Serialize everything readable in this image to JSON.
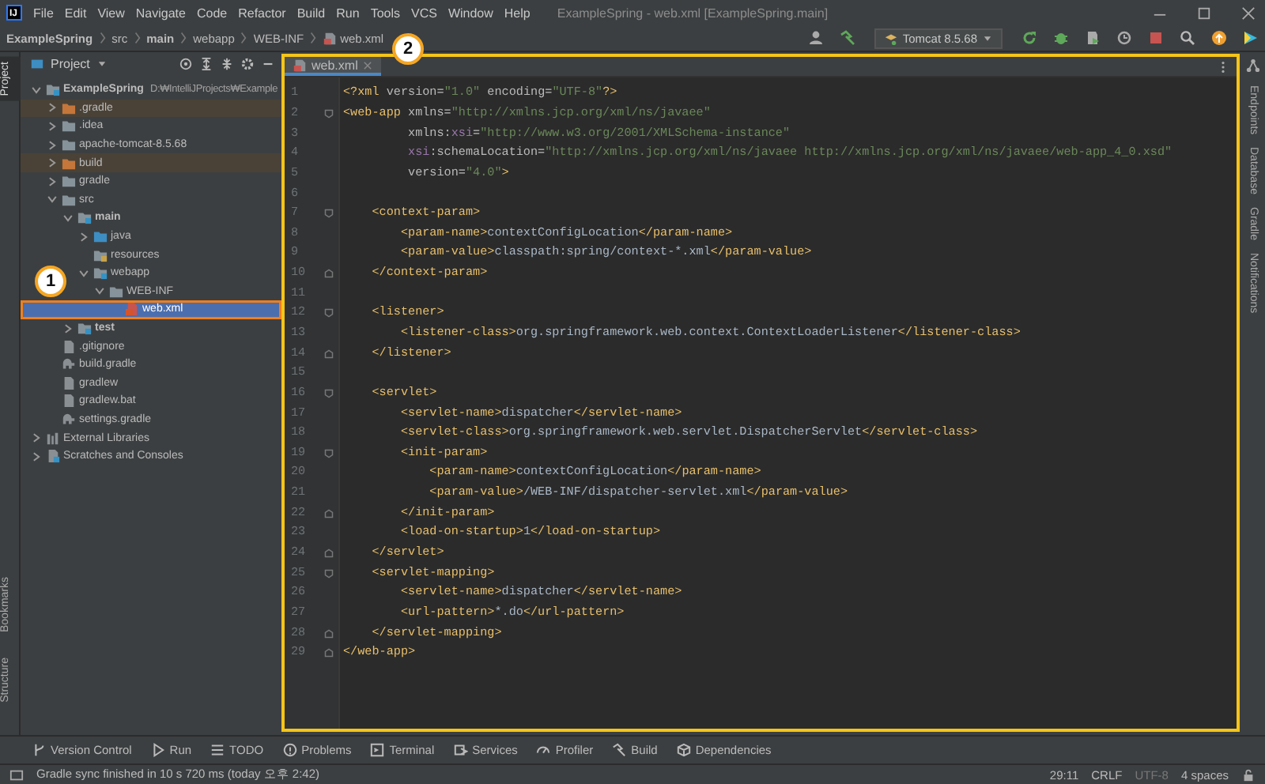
{
  "window": {
    "logo": "IJ",
    "title": "ExampleSpring - web.xml [ExampleSpring.main]"
  },
  "menu": [
    "File",
    "Edit",
    "View",
    "Navigate",
    "Code",
    "Refactor",
    "Build",
    "Run",
    "Tools",
    "VCS",
    "Window",
    "Help"
  ],
  "breadcrumbs": [
    {
      "label": "ExampleSpring",
      "bold": true
    },
    {
      "label": "src",
      "bold": false
    },
    {
      "label": "main",
      "bold": true
    },
    {
      "label": "webapp",
      "bold": false
    },
    {
      "label": "WEB-INF",
      "bold": false
    },
    {
      "label": "web.xml",
      "bold": false
    }
  ],
  "toolbar": {
    "run_config": "Tomcat 8.5.68"
  },
  "left_stripe": {
    "top": [
      {
        "label": "Project",
        "selected": true
      }
    ],
    "bottom": [
      {
        "label": "Bookmarks",
        "selected": false
      },
      {
        "label": "Structure",
        "selected": false
      }
    ]
  },
  "project_panel": {
    "title": "Project",
    "tree": [
      {
        "label": "ExampleSpring",
        "hint": "D:₩IntelliJProjects₩Example",
        "kind": "module",
        "bold": true,
        "expanded": true,
        "selected": false,
        "excluded": false,
        "children": [
          {
            "label": ".gradle",
            "kind": "excluded",
            "bold": false,
            "expanded": false,
            "selected": false,
            "excluded": true
          },
          {
            "label": ".idea",
            "kind": "folder",
            "bold": false,
            "expanded": false,
            "selected": false,
            "excluded": false
          },
          {
            "label": "apache-tomcat-8.5.68",
            "kind": "folder",
            "bold": false,
            "expanded": false,
            "selected": false,
            "excluded": false
          },
          {
            "label": "build",
            "kind": "excluded",
            "bold": false,
            "expanded": false,
            "selected": false,
            "excluded": true
          },
          {
            "label": "gradle",
            "kind": "folder",
            "bold": false,
            "expanded": false,
            "selected": false,
            "excluded": false
          },
          {
            "label": "src",
            "kind": "folder",
            "bold": false,
            "expanded": true,
            "selected": false,
            "excluded": false,
            "children": [
              {
                "label": "main",
                "kind": "module",
                "bold": true,
                "expanded": true,
                "selected": false,
                "excluded": false,
                "children": [
                  {
                    "label": "java",
                    "kind": "source",
                    "bold": false,
                    "expanded": false,
                    "selected": false,
                    "excluded": false
                  },
                  {
                    "label": "resources",
                    "kind": "resources",
                    "bold": false,
                    "selected": false,
                    "excluded": false
                  },
                  {
                    "label": "webapp",
                    "kind": "web",
                    "bold": false,
                    "expanded": true,
                    "selected": false,
                    "excluded": false,
                    "children": [
                      {
                        "label": "WEB-INF",
                        "kind": "folder",
                        "bold": false,
                        "expanded": true,
                        "selected": false,
                        "excluded": false,
                        "children": [
                          {
                            "label": "web.xml",
                            "kind": "xml",
                            "bold": false,
                            "selected": true,
                            "excluded": false
                          }
                        ]
                      }
                    ]
                  }
                ]
              },
              {
                "label": "test",
                "kind": "module",
                "bold": true,
                "expanded": false,
                "selected": false,
                "excluded": false
              }
            ]
          },
          {
            "label": ".gitignore",
            "kind": "ignore",
            "bold": false,
            "selected": false,
            "excluded": false
          },
          {
            "label": "build.gradle",
            "kind": "gradle",
            "bold": false,
            "selected": false,
            "excluded": false
          },
          {
            "label": "gradlew",
            "kind": "script",
            "bold": false,
            "selected": false,
            "excluded": false
          },
          {
            "label": "gradlew.bat",
            "kind": "text",
            "bold": false,
            "selected": false,
            "excluded": false
          },
          {
            "label": "settings.gradle",
            "kind": "gradle",
            "bold": false,
            "selected": false,
            "excluded": false
          }
        ]
      },
      {
        "label": "External Libraries",
        "kind": "libraries",
        "bold": false,
        "expanded": false,
        "selected": false,
        "excluded": false
      },
      {
        "label": "Scratches and Consoles",
        "kind": "scratches",
        "bold": false,
        "expanded": false,
        "selected": false,
        "excluded": false
      }
    ]
  },
  "editor": {
    "tabs": [
      {
        "label": "web.xml",
        "selected": true
      }
    ],
    "lines": [
      {
        "number": "1",
        "fold_start": false,
        "fold_end": false,
        "segments": [
          {
            "kind": "tag",
            "text": "<?xml "
          },
          {
            "kind": "attr",
            "text": "version="
          },
          {
            "kind": "str",
            "text": "\"1.0\""
          },
          {
            "kind": "attr",
            "text": " encoding="
          },
          {
            "kind": "str",
            "text": "\"UTF-8\""
          },
          {
            "kind": "tag",
            "text": "?>"
          }
        ]
      },
      {
        "number": "2",
        "fold_start": true,
        "fold_end": false,
        "segments": [
          {
            "kind": "tag",
            "text": "<web-app "
          },
          {
            "kind": "attr",
            "text": "xmlns="
          },
          {
            "kind": "str",
            "text": "\"http://xmlns.jcp.org/xml/ns/javaee\""
          }
        ]
      },
      {
        "number": "3",
        "fold_start": false,
        "fold_end": false,
        "segments": [
          {
            "kind": "attr",
            "text": "         xmlns:"
          },
          {
            "kind": "ns",
            "text": "xsi"
          },
          {
            "kind": "attr",
            "text": "="
          },
          {
            "kind": "str",
            "text": "\"http://www.w3.org/2001/XMLSchema-instance\""
          }
        ]
      },
      {
        "number": "4",
        "fold_start": false,
        "fold_end": false,
        "segments": [
          {
            "kind": "ns",
            "text": "         xsi"
          },
          {
            "kind": "attr",
            "text": ":schemaLocation="
          },
          {
            "kind": "str",
            "text": "\"http://xmlns.jcp.org/xml/ns/javaee http://xmlns.jcp.org/xml/ns/javaee/web-app_4_0.xsd\""
          }
        ]
      },
      {
        "number": "5",
        "fold_start": false,
        "fold_end": false,
        "segments": [
          {
            "kind": "attr",
            "text": "         version="
          },
          {
            "kind": "str",
            "text": "\"4.0\""
          },
          {
            "kind": "tag",
            "text": ">"
          }
        ]
      },
      {
        "number": "6",
        "fold_start": false,
        "fold_end": false
      },
      {
        "number": "7",
        "fold_start": true,
        "fold_end": false,
        "segments": [
          {
            "kind": "tag",
            "text": "    <context-param>"
          }
        ]
      },
      {
        "number": "8",
        "fold_start": false,
        "fold_end": false,
        "segments": [
          {
            "kind": "tag",
            "text": "        <param-name>"
          },
          {
            "kind": "text",
            "text": "contextConfigLocation"
          },
          {
            "kind": "tag",
            "text": "</param-name>"
          }
        ]
      },
      {
        "number": "9",
        "fold_start": false,
        "fold_end": false,
        "segments": [
          {
            "kind": "tag",
            "text": "        <param-value>"
          },
          {
            "kind": "text",
            "text": "classpath:spring/context-*.xml"
          },
          {
            "kind": "tag",
            "text": "</param-value>"
          }
        ]
      },
      {
        "number": "10",
        "fold_start": false,
        "fold_end": true,
        "segments": [
          {
            "kind": "tag",
            "text": "    </context-param>"
          }
        ]
      },
      {
        "number": "11",
        "fold_start": false,
        "fold_end": false
      },
      {
        "number": "12",
        "fold_start": true,
        "fold_end": false,
        "segments": [
          {
            "kind": "tag",
            "text": "    <listener>"
          }
        ]
      },
      {
        "number": "13",
        "fold_start": false,
        "fold_end": false,
        "segments": [
          {
            "kind": "tag",
            "text": "        <listener-class>"
          },
          {
            "kind": "text",
            "text": "org.springframework.web.context.ContextLoaderListener"
          },
          {
            "kind": "tag",
            "text": "</listener-class>"
          }
        ]
      },
      {
        "number": "14",
        "fold_start": false,
        "fold_end": true,
        "segments": [
          {
            "kind": "tag",
            "text": "    </listener>"
          }
        ]
      },
      {
        "number": "15",
        "fold_start": false,
        "fold_end": false
      },
      {
        "number": "16",
        "fold_start": true,
        "fold_end": false,
        "segments": [
          {
            "kind": "tag",
            "text": "    <servlet>"
          }
        ]
      },
      {
        "number": "17",
        "fold_start": false,
        "fold_end": false,
        "segments": [
          {
            "kind": "tag",
            "text": "        <servlet-name>"
          },
          {
            "kind": "text",
            "text": "dispatcher"
          },
          {
            "kind": "tag",
            "text": "</servlet-name>"
          }
        ]
      },
      {
        "number": "18",
        "fold_start": false,
        "fold_end": false,
        "segments": [
          {
            "kind": "tag",
            "text": "        <servlet-class>"
          },
          {
            "kind": "text",
            "text": "org.springframework.web.servlet.DispatcherServlet"
          },
          {
            "kind": "tag",
            "text": "</servlet-class>"
          }
        ]
      },
      {
        "number": "19",
        "fold_start": true,
        "fold_end": false,
        "segments": [
          {
            "kind": "tag",
            "text": "        <init-param>"
          }
        ]
      },
      {
        "number": "20",
        "fold_start": false,
        "fold_end": false,
        "segments": [
          {
            "kind": "tag",
            "text": "            <param-name>"
          },
          {
            "kind": "text",
            "text": "contextConfigLocation"
          },
          {
            "kind": "tag",
            "text": "</param-name>"
          }
        ]
      },
      {
        "number": "21",
        "fold_start": false,
        "fold_end": false,
        "segments": [
          {
            "kind": "tag",
            "text": "            <param-value>"
          },
          {
            "kind": "text",
            "text": "/WEB-INF/dispatcher-servlet.xml"
          },
          {
            "kind": "tag",
            "text": "</param-value>"
          }
        ]
      },
      {
        "number": "22",
        "fold_start": false,
        "fold_end": true,
        "segments": [
          {
            "kind": "tag",
            "text": "        </init-param>"
          }
        ]
      },
      {
        "number": "23",
        "fold_start": false,
        "fold_end": false,
        "segments": [
          {
            "kind": "tag",
            "text": "        <load-on-startup>"
          },
          {
            "kind": "text",
            "text": "1"
          },
          {
            "kind": "tag",
            "text": "</load-on-startup>"
          }
        ]
      },
      {
        "number": "24",
        "fold_start": false,
        "fold_end": true,
        "segments": [
          {
            "kind": "tag",
            "text": "    </servlet>"
          }
        ]
      },
      {
        "number": "25",
        "fold_start": true,
        "fold_end": false,
        "segments": [
          {
            "kind": "tag",
            "text": "    <servlet-mapping>"
          }
        ]
      },
      {
        "number": "26",
        "fold_start": false,
        "fold_end": false,
        "segments": [
          {
            "kind": "tag",
            "text": "        <servlet-name>"
          },
          {
            "kind": "text",
            "text": "dispatcher"
          },
          {
            "kind": "tag",
            "text": "</servlet-name>"
          }
        ]
      },
      {
        "number": "27",
        "fold_start": false,
        "fold_end": false,
        "segments": [
          {
            "kind": "tag",
            "text": "        <url-pattern>"
          },
          {
            "kind": "text",
            "text": "*.do"
          },
          {
            "kind": "tag",
            "text": "</url-pattern>"
          }
        ]
      },
      {
        "number": "28",
        "fold_start": false,
        "fold_end": true,
        "segments": [
          {
            "kind": "tag",
            "text": "    </servlet-mapping>"
          }
        ]
      },
      {
        "number": "29",
        "fold_start": false,
        "fold_end": true,
        "segments": [
          {
            "kind": "tag",
            "text": "</web-app>"
          }
        ]
      }
    ]
  },
  "right_stripe": [
    {
      "label": "Endpoints"
    },
    {
      "label": "Database"
    },
    {
      "label": "Gradle"
    },
    {
      "label": "Notifications"
    }
  ],
  "bottom_tools": [
    "Version Control",
    "Run",
    "TODO",
    "Problems",
    "Terminal",
    "Services",
    "Profiler",
    "Build",
    "Dependencies"
  ],
  "status_bar": {
    "message": "Gradle sync finished in 10 s 720 ms (today 오후 2:42)",
    "position": "29:11",
    "line_separator": "CRLF",
    "encoding": "UTF-8",
    "indent": "4 spaces"
  },
  "callouts": [
    {
      "label": "1"
    },
    {
      "label": "2"
    }
  ]
}
